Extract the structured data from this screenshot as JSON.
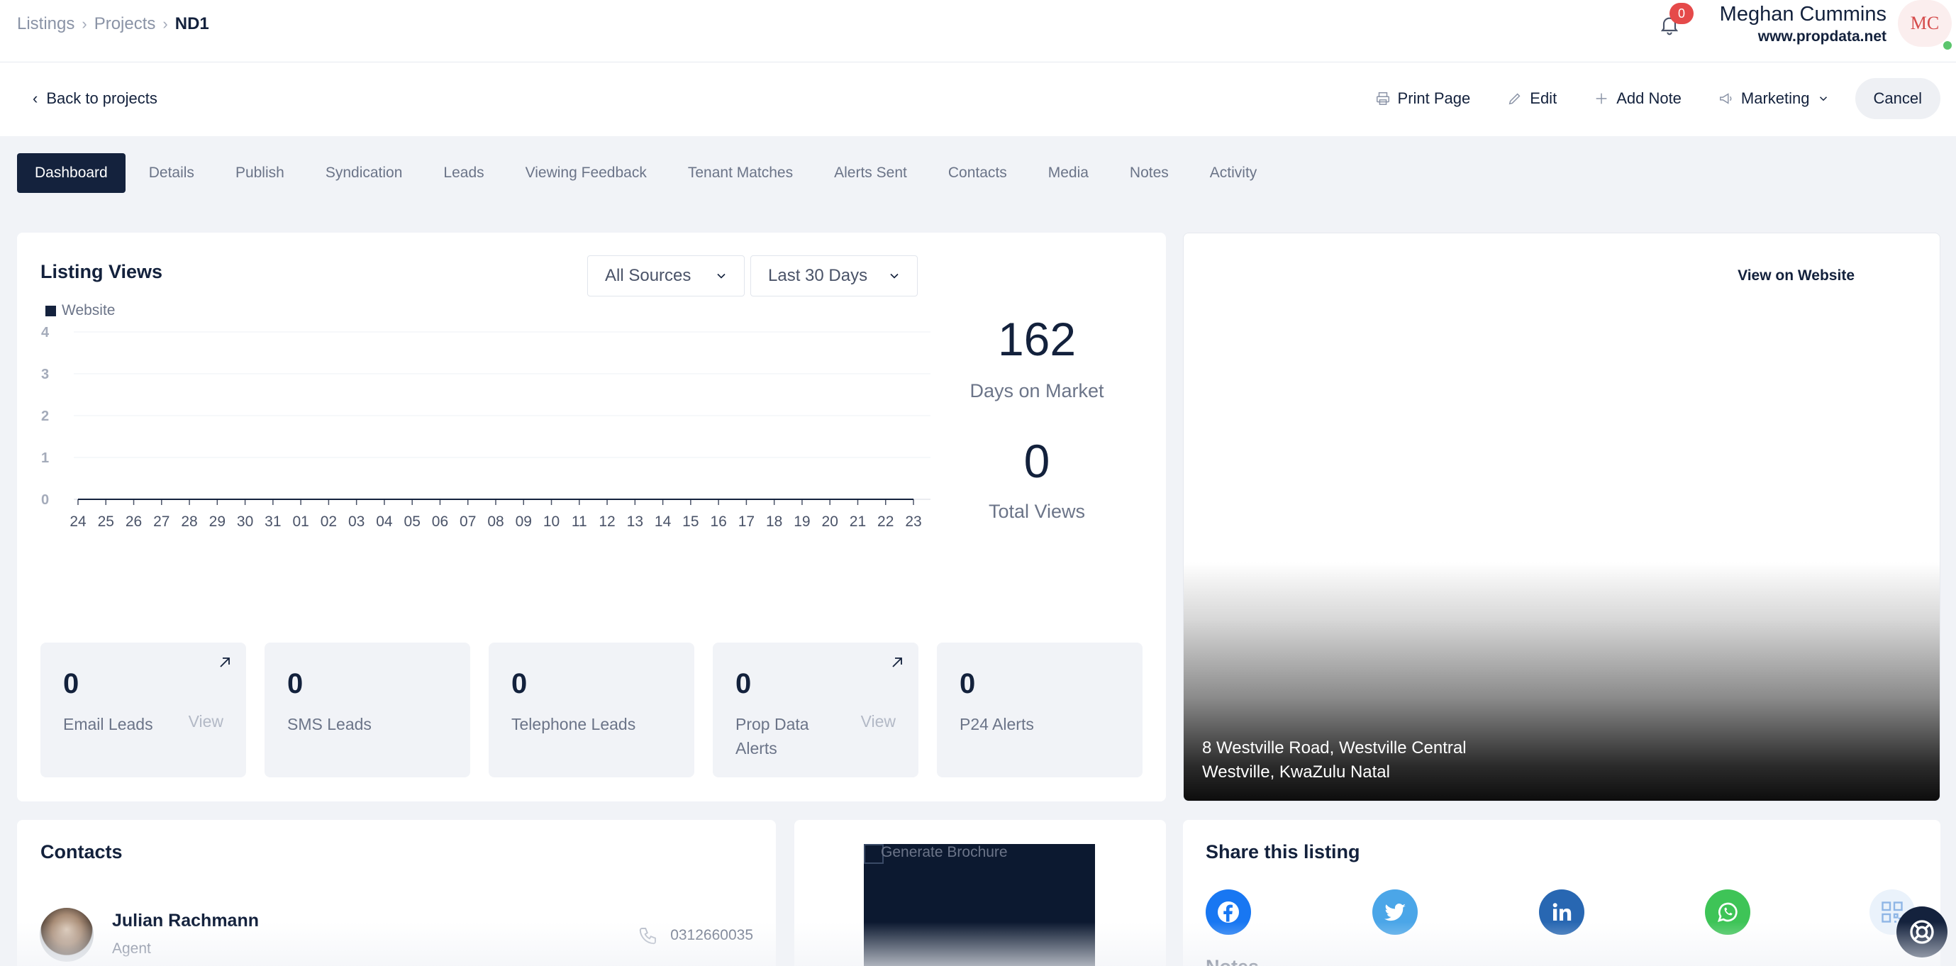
{
  "breadcrumb": {
    "items": [
      "Listings",
      "Projects"
    ],
    "current": "ND1"
  },
  "notifications": {
    "count": "0"
  },
  "user": {
    "name": "Meghan Cummins",
    "site": "www.propdata.net",
    "initials": "MC"
  },
  "actionbar": {
    "back_label": "Back to projects",
    "print_label": "Print Page",
    "edit_label": "Edit",
    "add_note_label": "Add Note",
    "marketing_label": "Marketing",
    "cancel_label": "Cancel"
  },
  "tabs": [
    "Dashboard",
    "Details",
    "Publish",
    "Syndication",
    "Leads",
    "Viewing Feedback",
    "Tenant Matches",
    "Alerts Sent",
    "Contacts",
    "Media",
    "Notes",
    "Activity"
  ],
  "active_tab": "Dashboard",
  "listing_views": {
    "title": "Listing Views",
    "source_filter": "All Sources",
    "period_filter": "Last 30 Days",
    "legend": "Website"
  },
  "chart_data": {
    "type": "line",
    "x": [
      "24",
      "25",
      "26",
      "27",
      "28",
      "29",
      "30",
      "31",
      "01",
      "02",
      "03",
      "04",
      "05",
      "06",
      "07",
      "08",
      "09",
      "10",
      "11",
      "12",
      "13",
      "14",
      "15",
      "16",
      "17",
      "18",
      "19",
      "20",
      "21",
      "22",
      "23"
    ],
    "series": [
      {
        "name": "Website",
        "values": [
          0,
          0,
          0,
          0,
          0,
          0,
          0,
          0,
          0,
          0,
          0,
          0,
          0,
          0,
          0,
          0,
          0,
          0,
          0,
          0,
          0,
          0,
          0,
          0,
          0,
          0,
          0,
          0,
          0,
          0,
          0
        ]
      }
    ],
    "ylim": [
      0,
      4
    ],
    "yticks": [
      "0",
      "1",
      "2",
      "3",
      "4"
    ],
    "grid": true,
    "legend": "top-left",
    "color": "#14223d"
  },
  "stats": {
    "days_on_market": {
      "value": "162",
      "label": "Days on Market"
    },
    "total_views": {
      "value": "0",
      "label": "Total Views"
    }
  },
  "leads": [
    {
      "value": "0",
      "label": "Email Leads",
      "view": "View"
    },
    {
      "value": "0",
      "label": "SMS Leads"
    },
    {
      "value": "0",
      "label": "Telephone Leads"
    },
    {
      "value": "0",
      "label": "Prop Data Alerts",
      "view": "View"
    },
    {
      "value": "0",
      "label": "P24 Alerts"
    }
  ],
  "listing_image": {
    "view_link": "View on Website",
    "address_line1": "8 Westville Road, Westville Central",
    "address_line2": "Westville, KwaZulu Natal"
  },
  "contacts": {
    "title": "Contacts",
    "items": [
      {
        "name": "Julian Rachmann",
        "role": "Agent",
        "phone": "0312660035"
      }
    ]
  },
  "brochure": {
    "label": "Generate Brochure"
  },
  "share": {
    "title": "Share this listing",
    "notes_title": "Notes"
  },
  "colors": {
    "navy": "#14223d",
    "facebook": "#1877f2",
    "twitter": "#4ba6e8",
    "linkedin": "#2867b2",
    "whatsapp": "#3ec457",
    "badge": "#e54a4a"
  }
}
